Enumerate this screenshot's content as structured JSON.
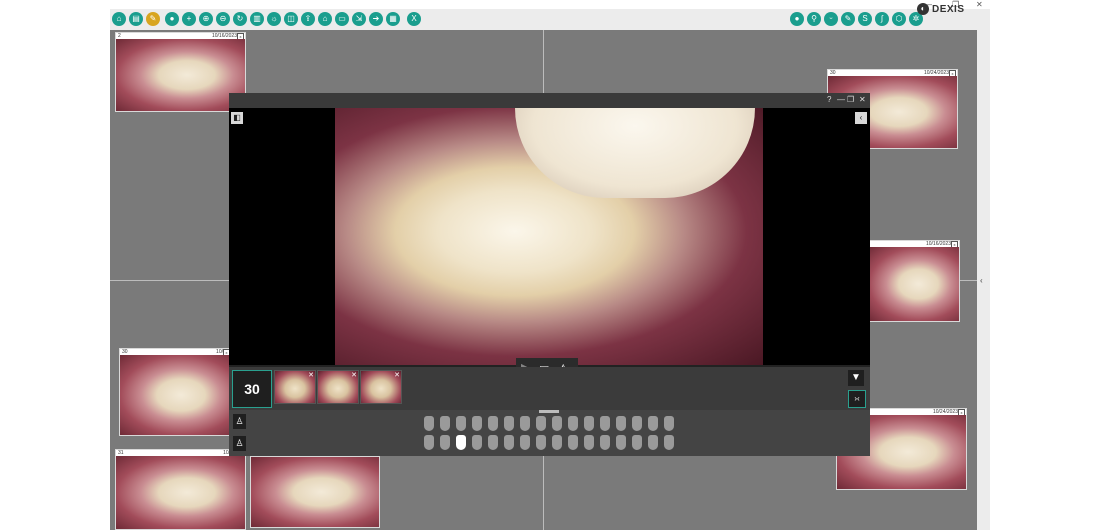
{
  "window": {
    "controls": [
      "—",
      "❐",
      "✕"
    ]
  },
  "toolbar": {
    "left_icons": [
      "tooth-icon",
      "printer-icon",
      "pencil-icon",
      "camera-icon",
      "crosshair-icon",
      "zoom-in-icon",
      "zoom-out-icon",
      "rotate-icon",
      "document-icon",
      "brightness-icon",
      "compare-icon",
      "export-icon",
      "home-icon",
      "folder-icon",
      "import-icon",
      "send-icon",
      "print-icon",
      "close-x-icon"
    ],
    "right_icons": [
      "circle-icon",
      "probe-icon",
      "teeth-icon",
      "pen-icon",
      "s-icon",
      "curve-icon",
      "tooth-select-icon",
      "settings-icon"
    ],
    "logo": "DEXIS"
  },
  "thumbnails": [
    {
      "label": "2",
      "date": "10/16/2023"
    },
    {
      "label": "30",
      "date": "10/24/2023"
    },
    {
      "label": "",
      "date": "10/16/2023"
    },
    {
      "label": "30",
      "date": "10/"
    },
    {
      "label": "31",
      "date": "10/16/"
    },
    {
      "label": "",
      "date": "10/24/2023"
    }
  ],
  "viewer": {
    "title": "",
    "controls": [
      "?",
      "—",
      "❐",
      "✕"
    ],
    "count": "30",
    "thumb_close": "✕",
    "tooth_count": 16,
    "selected_tooth_index": 2
  },
  "right_strip": {
    "chevron": "‹"
  }
}
